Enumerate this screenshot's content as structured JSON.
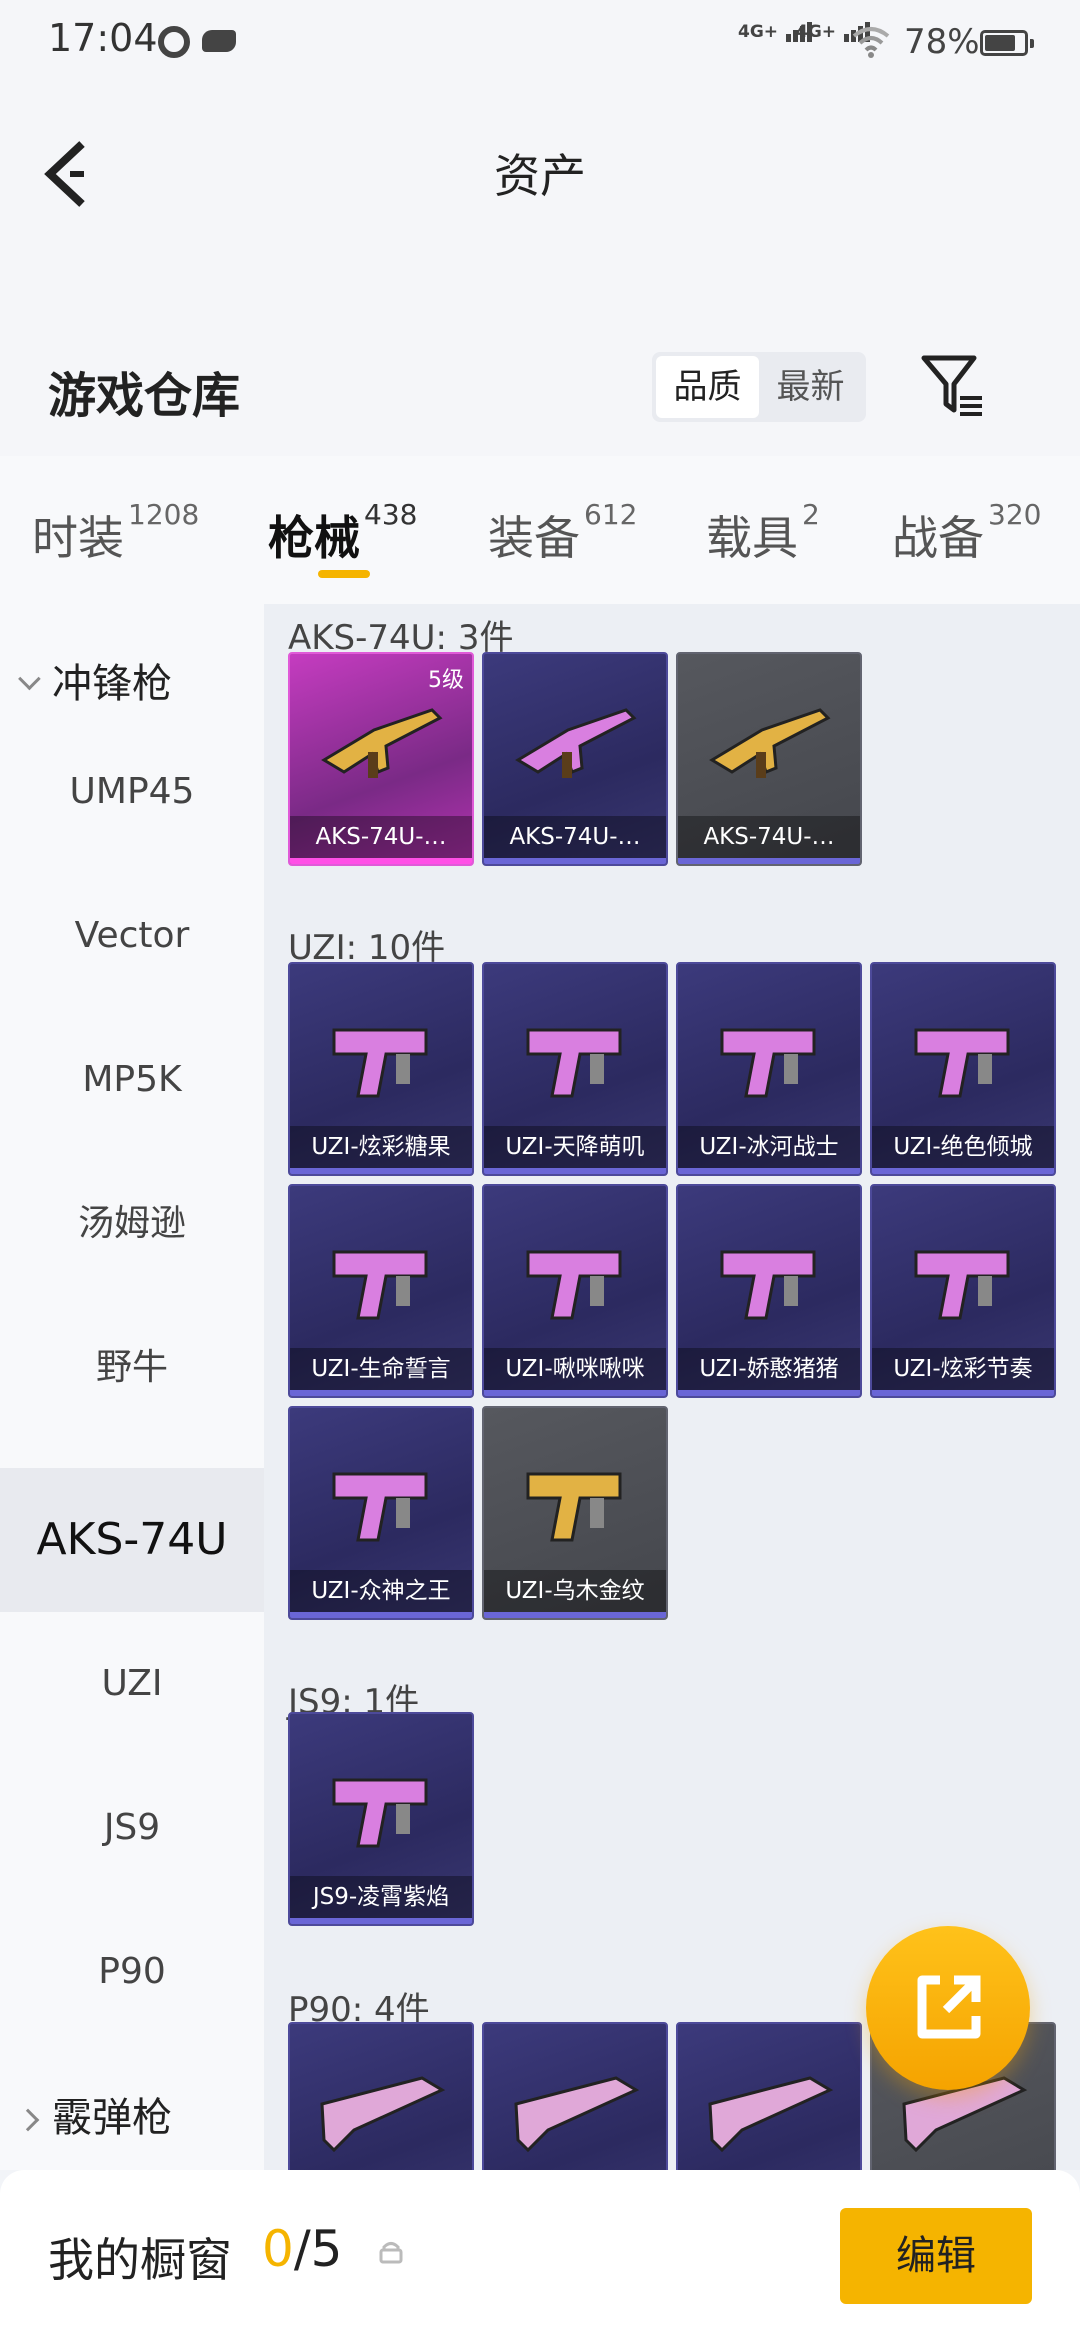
{
  "status_bar": {
    "time": "17:04",
    "signal1": "4G+",
    "signal2": "4G+",
    "battery": "78%"
  },
  "header": {
    "title": "资产",
    "section_title": "游戏仓库",
    "sort_options": [
      "品质",
      "最新"
    ],
    "sort_active": "品质"
  },
  "tabs": [
    {
      "label": "时装",
      "count": "1208"
    },
    {
      "label": "枪械",
      "count": "438",
      "active": true
    },
    {
      "label": "装备",
      "count": "612"
    },
    {
      "label": "载具",
      "count": "2"
    },
    {
      "label": "战备",
      "count": "320"
    }
  ],
  "sidebar": {
    "group_open": "冲锋枪",
    "items": [
      "UMP45",
      "Vector",
      "MP5K",
      "汤姆逊",
      "野牛",
      "AKS-74U",
      "UZI",
      "JS9",
      "P90"
    ],
    "active_item": "AKS-74U",
    "group_closed": "霰弹枪"
  },
  "groups": [
    {
      "title": "AKS-74U: 3件",
      "items": [
        {
          "name": "AKS-74U-…",
          "level": "5级",
          "tier": "gold",
          "icon": "rifle-icon"
        },
        {
          "name": "AKS-74U-…",
          "tier": "purple",
          "icon": "rifle-icon"
        },
        {
          "name": "AKS-74U-…",
          "tier": "grey",
          "icon": "rifle-icon"
        }
      ]
    },
    {
      "title": "UZI: 10件",
      "items": [
        {
          "name": "UZI-炫彩糖果",
          "tier": "purple",
          "icon": "smg-icon"
        },
        {
          "name": "UZI-天降萌叽",
          "tier": "purple",
          "icon": "smg-icon"
        },
        {
          "name": "UZI-冰河战士",
          "tier": "purple",
          "icon": "smg-icon"
        },
        {
          "name": "UZI-绝色倾城",
          "tier": "purple",
          "icon": "smg-icon"
        },
        {
          "name": "UZI-生命誓言",
          "tier": "purple",
          "icon": "smg-icon"
        },
        {
          "name": "UZI-啾咪啾咪",
          "tier": "purple",
          "icon": "smg-icon"
        },
        {
          "name": "UZI-娇憨猪猪",
          "tier": "purple",
          "icon": "smg-icon"
        },
        {
          "name": "UZI-炫彩节奏",
          "tier": "purple",
          "icon": "smg-icon"
        },
        {
          "name": "UZI-众神之王",
          "tier": "purple",
          "icon": "smg-icon"
        },
        {
          "name": "UZI-乌木金纹",
          "tier": "grey",
          "icon": "smg-icon"
        }
      ]
    },
    {
      "title": "JS9: 1件",
      "items": [
        {
          "name": "JS9-凌霄紫焰",
          "tier": "purple",
          "icon": "smg-icon"
        }
      ]
    },
    {
      "title": "P90: 4件",
      "items": [
        {
          "name": "",
          "tier": "purple",
          "icon": "p90-icon"
        },
        {
          "name": "",
          "tier": "purple",
          "icon": "p90-icon"
        },
        {
          "name": "",
          "tier": "purple",
          "icon": "p90-icon"
        },
        {
          "name": "",
          "tier": "grey",
          "icon": "p90-icon"
        }
      ]
    }
  ],
  "bottom_bar": {
    "label": "我的橱窗",
    "used": "0",
    "total": "/5",
    "edit_label": "编辑"
  },
  "colors": {
    "accent": "#f5b400",
    "gold_card": "#c53cc0",
    "purple_card": "#3c3a7c",
    "grey_card": "#56585e"
  }
}
